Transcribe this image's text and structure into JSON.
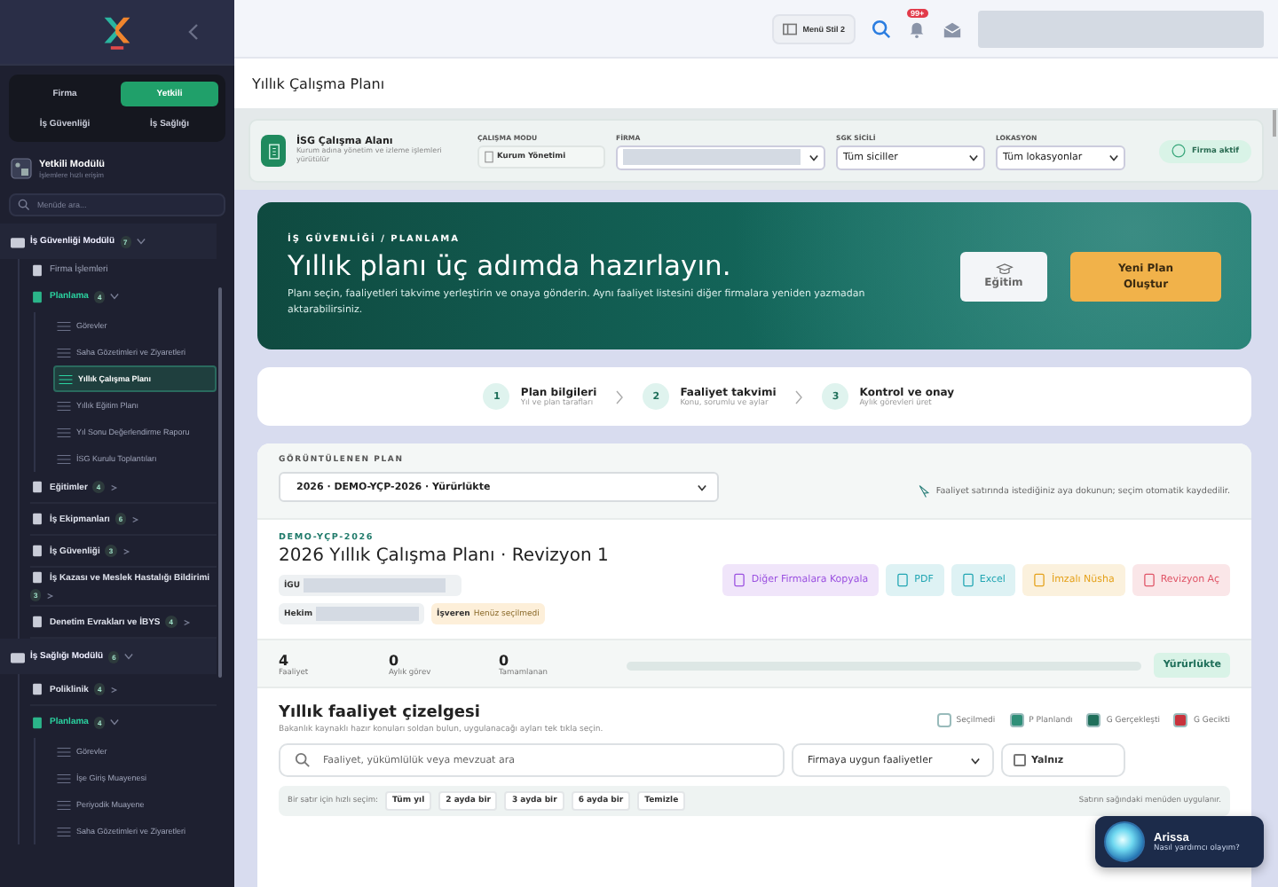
{
  "sidebar": {
    "role_tabs": [
      {
        "label": "Firma",
        "selected": false
      },
      {
        "label": "Yetkili",
        "selected": true
      }
    ],
    "module_tabs": [
      {
        "label": "İş Güvenliği"
      },
      {
        "label": "İş Sağlığı"
      }
    ],
    "module": {
      "title": "Yetkili Modülü",
      "subtitle": "İşlemlere hızlı erişim"
    },
    "search": {
      "placeholder": "Menüde ara..."
    },
    "tree": [
      {
        "label": "İş Güvenliği Modülü",
        "badge": "7",
        "expanded": true,
        "children": [
          {
            "label": "Firma İşlemleri",
            "kind": "link",
            "expanded": false
          },
          {
            "label": "Planlama",
            "badge": "4",
            "kind": "group",
            "expanded": true,
            "children": [
              {
                "label": "Görevler",
                "selected": false
              },
              {
                "label": "Saha Gözetimleri ve Ziyaretleri",
                "selected": false
              },
              {
                "label": "Yıllık Çalışma Planı",
                "selected": true
              },
              {
                "label": "Yıllık Eğitim Planı",
                "selected": false
              },
              {
                "label": "Yıl Sonu Değerlendirme Raporu",
                "selected": false
              },
              {
                "label": "İSG Kurulu Toplantıları",
                "selected": false
              }
            ]
          },
          {
            "label": "Eğitimler",
            "badge": "4",
            "kind": "group",
            "expanded": false
          },
          {
            "label": "İş Ekipmanları",
            "badge": "6",
            "kind": "group",
            "expanded": false
          },
          {
            "label": "İş Güvenliği",
            "badge": "3",
            "kind": "group",
            "expanded": false
          },
          {
            "label": "İş Kazası ve Meslek Hastalığı Bildirimi",
            "badge": "3",
            "kind": "group",
            "expanded": false
          },
          {
            "label": "Denetim Evrakları ve İBYS",
            "badge": "4",
            "kind": "group",
            "expanded": false
          }
        ]
      },
      {
        "label": "İş Sağlığı Modülü",
        "badge": "6",
        "expanded": true,
        "children": [
          {
            "label": "Poliklinik",
            "badge": "4",
            "kind": "group",
            "expanded": false
          },
          {
            "label": "Planlama",
            "badge": "4",
            "kind": "group",
            "expanded": true,
            "children": [
              {
                "label": "Görevler",
                "selected": false
              },
              {
                "label": "İşe Giriş Muayenesi",
                "selected": false
              },
              {
                "label": "Periyodik Muayene",
                "selected": false
              },
              {
                "label": "Saha Gözetimleri ve Ziyaretleri",
                "selected": false
              }
            ]
          }
        ]
      }
    ]
  },
  "topbar": {
    "menu_style": "Menü Stil 2",
    "notifications": "99+"
  },
  "page_title": "Yıllık Çalışma Planı",
  "workspace": {
    "title": "İSG Çalışma Alanı",
    "subtitle": "Kurum adına yönetim ve izleme işlemleri yürütülür",
    "fields": [
      {
        "label": "ÇALIŞMA MODU",
        "kind": "static",
        "value": "Kurum Yönetimi"
      },
      {
        "label": "FİRMA",
        "kind": "hidden"
      },
      {
        "label": "SGK SİCİLİ",
        "kind": "select",
        "value": "Tüm siciller"
      },
      {
        "label": "LOKASYON",
        "kind": "select",
        "value": "Tüm lokasyonlar"
      }
    ],
    "status": "Firma aktif"
  },
  "hero": {
    "kicker": "İŞ GÜVENLİĞİ / PLANLAMA",
    "title": "Yıllık planı üç adımda hazırlayın.",
    "description": "Planı seçin, faaliyetleri takvime yerleştirin ve onaya gönderin. Aynı faaliyet listesini diğer firmalara yeniden yazmadan aktarabilirsiniz.",
    "buttons": [
      {
        "label": "Eğitim",
        "kind": "secondary"
      },
      {
        "label": "Yeni Plan Oluştur",
        "kind": "primary"
      }
    ]
  },
  "steps": [
    {
      "number": "1",
      "title": "Plan bilgileri",
      "subtitle": "Yıl ve plan tarafları"
    },
    {
      "number": "2",
      "title": "Faaliyet takvimi",
      "subtitle": "Konu, sorumlu ve aylar"
    },
    {
      "number": "3",
      "title": "Kontrol ve onay",
      "subtitle": "Aylık görevleri üret"
    }
  ],
  "plan": {
    "label": "GÖRÜNTÜLENEN PLAN",
    "selected_plan": "2026 · DEMO-YÇP-2026 · Yürürlükte",
    "hint": "Faaliyet satırında istediğiniz aya dokunun; seçim otomatik kaydedilir.",
    "code": "DEMO-YÇP-2026",
    "title": "2026 Yıllık Çalışma Planı · Revizyon 1",
    "people": [
      {
        "role": "İGU",
        "kind": "hidden"
      },
      {
        "role": "Hekim",
        "kind": "hidden"
      },
      {
        "role": "İşveren",
        "kind": "text",
        "value": "Henüz seçilmedi"
      }
    ],
    "actions": [
      {
        "label": "Diğer Firmalara Kopyala",
        "color": "#9b51e0"
      },
      {
        "label": "PDF",
        "color": "#22a6b3"
      },
      {
        "label": "Excel",
        "color": "#22a6b3"
      },
      {
        "label": "İmzalı Nüsha",
        "color": "#e5a21c"
      },
      {
        "label": "Revizyon Aç",
        "color": "#e05567"
      }
    ],
    "stats": [
      {
        "value": "4",
        "label": "Faaliyet"
      },
      {
        "value": "0",
        "label": "Aylık görev"
      },
      {
        "value": "0",
        "label": "Tamamlanan"
      }
    ],
    "progress": {
      "level": 0
    },
    "status": "Yürürlükte"
  },
  "schedule": {
    "title": "Yıllık faaliyet çizelgesi",
    "subtitle": "Bakanlık kaynaklı hazır konuları soldan bulun, uygulanacağı ayları tek tıkla seçin.",
    "legend": [
      {
        "label": "Seçilmedi",
        "color": "#ffffff"
      },
      {
        "label": "P Planlandı",
        "color": "#2f8f78"
      },
      {
        "label": "G Gerçekleşti",
        "color": "#1f6f5a"
      },
      {
        "label": "G Gecikti",
        "color": "#c8323c"
      }
    ],
    "search": {
      "placeholder": "Faaliyet, yükümlülük veya mevzuat ara"
    },
    "filter": "Firmaya uygun faaliyetler",
    "only": {
      "label": "Yalnız",
      "checked": false
    },
    "quick_label": "Bir satır için hızlı seçim:",
    "quick": [
      "Tüm yıl",
      "2 ayda bir",
      "3 ayda bir",
      "6 ayda bir",
      "Temizle"
    ],
    "quick_note": "Satırın sağındaki menüden uygulanır."
  },
  "assistant": {
    "name": "Arissa",
    "prompt": "Nasıl yardımcı olayım?"
  }
}
